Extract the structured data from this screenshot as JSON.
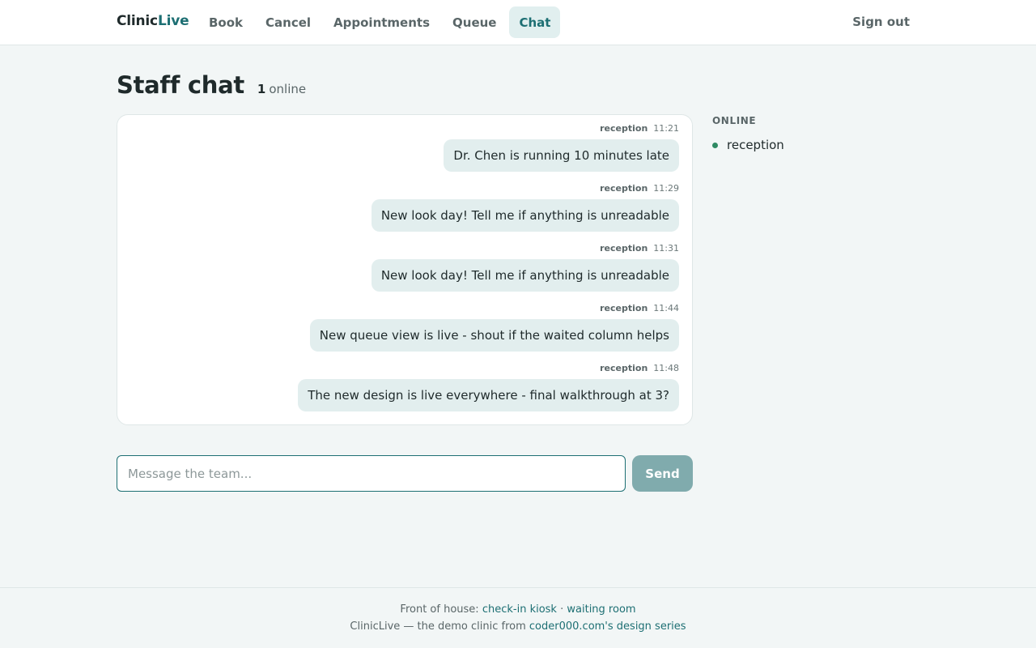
{
  "nav": {
    "brand_part1": "Clinic",
    "brand_part2": "Live",
    "items": [
      {
        "label": "Book"
      },
      {
        "label": "Cancel"
      },
      {
        "label": "Appointments"
      },
      {
        "label": "Queue"
      },
      {
        "label": "Chat",
        "active": true
      }
    ],
    "sign_out": "Sign out"
  },
  "page": {
    "title": "Staff chat",
    "online_count": "1",
    "online_label": "online"
  },
  "messages": [
    {
      "author": "reception",
      "time": "11:21",
      "text": "Dr. Chen is running 10 minutes late"
    },
    {
      "author": "reception",
      "time": "11:29",
      "text": "New look day! Tell me if anything is unreadable"
    },
    {
      "author": "reception",
      "time": "11:31",
      "text": "New look day! Tell me if anything is unreadable"
    },
    {
      "author": "reception",
      "time": "11:44",
      "text": "New queue view is live - shout if the waited column helps"
    },
    {
      "author": "reception",
      "time": "11:48",
      "text": "The new design is live everywhere - final walkthrough at 3?"
    }
  ],
  "composer": {
    "placeholder": "Message the team...",
    "value": "",
    "send_label": "Send"
  },
  "online": {
    "heading": "ONLINE",
    "users": [
      "reception"
    ],
    "dot_color": "#2f8a63"
  },
  "footer": {
    "line1_prefix": "Front of house:",
    "link_kiosk": "check-in kiosk",
    "separator": "·",
    "link_waiting": "waiting room",
    "line2_prefix": "ClinicLive — the demo clinic from",
    "link_series": "coder000.com's design series"
  },
  "colors": {
    "accent": "#1d6f73",
    "background": "#f2f6f6",
    "bubble": "#e2eeee",
    "send_button": "#80abad",
    "active_tab_bg": "#e1efef"
  }
}
